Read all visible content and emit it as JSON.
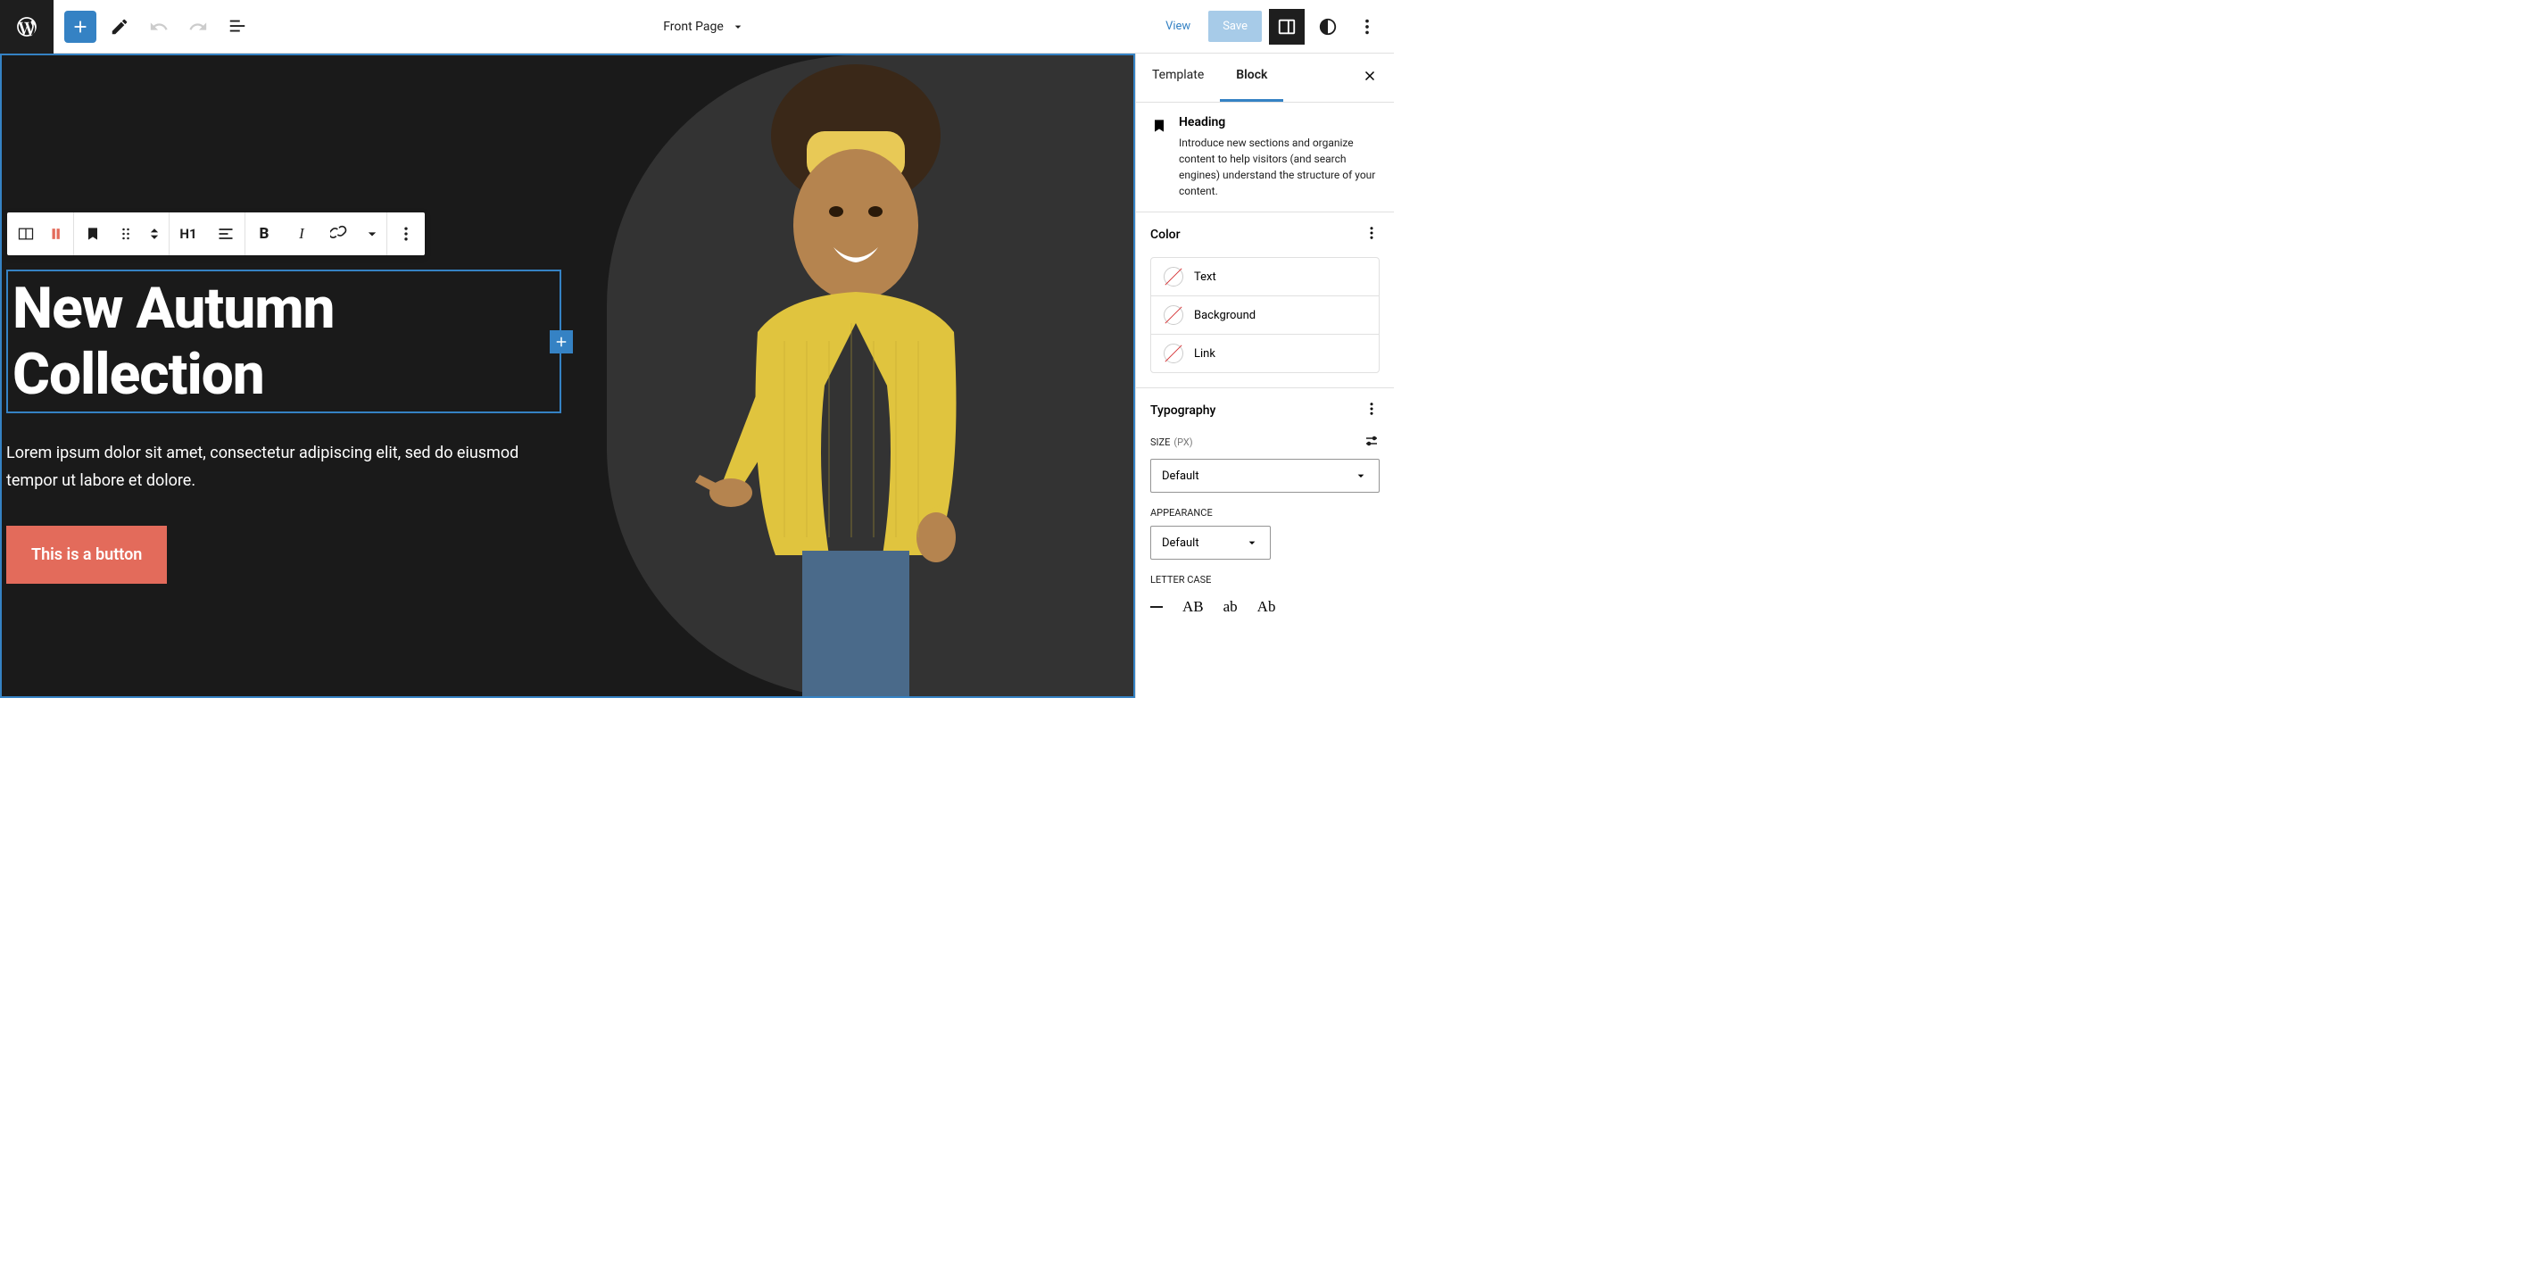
{
  "topbar": {
    "page_title": "Front Page",
    "view_label": "View",
    "save_label": "Save"
  },
  "canvas": {
    "heading": "New Autumn Collection",
    "paragraph": "Lorem ipsum dolor sit amet, consectetur adipiscing elit, sed do eiusmod tempor ut labore et dolore.",
    "button_label": "This is a button",
    "h1_label": "H1"
  },
  "sidebar": {
    "tabs": {
      "template": "Template",
      "block": "Block"
    },
    "block_info": {
      "title": "Heading",
      "description": "Introduce new sections and organize content to help visitors (and search engines) understand the structure of your content."
    },
    "color": {
      "title": "Color",
      "items": [
        "Text",
        "Background",
        "Link"
      ]
    },
    "typography": {
      "title": "Typography",
      "size_label": "SIZE",
      "size_unit": "(PX)",
      "size_value": "Default",
      "appearance_label": "APPEARANCE",
      "appearance_value": "Default",
      "letter_case_label": "LETTER CASE",
      "case_options": [
        "AB",
        "ab",
        "Ab"
      ]
    }
  }
}
